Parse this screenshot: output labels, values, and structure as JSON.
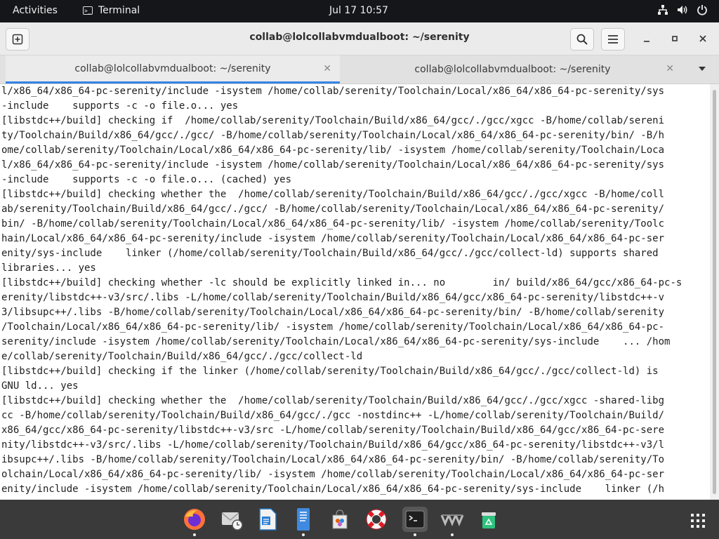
{
  "topbar": {
    "activities": "Activities",
    "app_name": "Terminal",
    "clock": "Jul 17  10:57",
    "tray_icons": [
      "network-icon",
      "volume-icon",
      "power-icon"
    ]
  },
  "window": {
    "title": "collab@lolcollabvmdualboot: ~/serenity",
    "tabs": [
      {
        "label": "collab@lolcollabvmdualboot: ~/serenity",
        "active": true
      },
      {
        "label": "collab@lolcollabvmdualboot: ~/serenity",
        "active": false
      }
    ]
  },
  "terminal": {
    "lines": [
      "l/x86_64/x86_64-pc-serenity/include -isystem /home/collab/serenity/Toolchain/Local/x86_64/x86_64-pc-serenity/sys",
      "-include    supports -c -o file.o... yes",
      "[libstdc++/build] checking if  /home/collab/serenity/Toolchain/Build/x86_64/gcc/./gcc/xgcc -B/home/collab/sereni",
      "ty/Toolchain/Build/x86_64/gcc/./gcc/ -B/home/collab/serenity/Toolchain/Local/x86_64/x86_64-pc-serenity/bin/ -B/h",
      "ome/collab/serenity/Toolchain/Local/x86_64/x86_64-pc-serenity/lib/ -isystem /home/collab/serenity/Toolchain/Loca",
      "l/x86_64/x86_64-pc-serenity/include -isystem /home/collab/serenity/Toolchain/Local/x86_64/x86_64-pc-serenity/sys",
      "-include    supports -c -o file.o... (cached) yes",
      "[libstdc++/build] checking whether the  /home/collab/serenity/Toolchain/Build/x86_64/gcc/./gcc/xgcc -B/home/coll",
      "ab/serenity/Toolchain/Build/x86_64/gcc/./gcc/ -B/home/collab/serenity/Toolchain/Local/x86_64/x86_64-pc-serenity/",
      "bin/ -B/home/collab/serenity/Toolchain/Local/x86_64/x86_64-pc-serenity/lib/ -isystem /home/collab/serenity/Toolc",
      "hain/Local/x86_64/x86_64-pc-serenity/include -isystem /home/collab/serenity/Toolchain/Local/x86_64/x86_64-pc-ser",
      "enity/sys-include    linker (/home/collab/serenity/Toolchain/Build/x86_64/gcc/./gcc/collect-ld) supports shared",
      "libraries... yes",
      "[libstdc++/build] checking whether -lc should be explicitly linked in... no        in/ build/x86_64/gcc/x86_64-pc-s",
      "erenity/libstdc++-v3/src/.libs -L/home/collab/serenity/Toolchain/Build/x86_64/gcc/x86_64-pc-serenity/libstdc++-v",
      "3/libsupc++/.libs -B/home/collab/serenity/Toolchain/Local/x86_64/x86_64-pc-serenity/bin/ -B/home/collab/serenity",
      "/Toolchain/Local/x86_64/x86_64-pc-serenity/lib/ -isystem /home/collab/serenity/Toolchain/Local/x86_64/x86_64-pc-",
      "serenity/include -isystem /home/collab/serenity/Toolchain/Local/x86_64/x86_64-pc-serenity/sys-include    ... /hom",
      "e/collab/serenity/Toolchain/Build/x86_64/gcc/./gcc/collect-ld",
      "[libstdc++/build] checking if the linker (/home/collab/serenity/Toolchain/Build/x86_64/gcc/./gcc/collect-ld) is",
      "GNU ld... yes",
      "[libstdc++/build] checking whether the  /home/collab/serenity/Toolchain/Build/x86_64/gcc/./gcc/xgcc -shared-libg",
      "cc -B/home/collab/serenity/Toolchain/Build/x86_64/gcc/./gcc -nostdinc++ -L/home/collab/serenity/Toolchain/Build/",
      "x86_64/gcc/x86_64-pc-serenity/libstdc++-v3/src -L/home/collab/serenity/Toolchain/Build/x86_64/gcc/x86_64-pc-sere",
      "nity/libstdc++-v3/src/.libs -L/home/collab/serenity/Toolchain/Build/x86_64/gcc/x86_64-pc-serenity/libstdc++-v3/l",
      "ibsupc++/.libs -B/home/collab/serenity/Toolchain/Local/x86_64/x86_64-pc-serenity/bin/ -B/home/collab/serenity/To",
      "olchain/Local/x86_64/x86_64-pc-serenity/lib/ -isystem /home/collab/serenity/Toolchain/Local/x86_64/x86_64-pc-ser",
      "enity/include -isystem /home/collab/serenity/Toolchain/Local/x86_64/x86_64-pc-serenity/sys-include    linker (/h"
    ]
  },
  "dock": {
    "items": [
      {
        "name": "firefox-icon",
        "running": true
      },
      {
        "name": "mail-clock-icon",
        "running": false
      },
      {
        "name": "writer-document-icon",
        "running": false
      },
      {
        "name": "text-editor-icon",
        "running": true
      },
      {
        "name": "software-store-icon",
        "running": false
      },
      {
        "name": "help-lifebuoy-icon",
        "running": false
      },
      {
        "name": "terminal-icon",
        "running": true
      },
      {
        "name": "virtual-machine-icon",
        "running": true
      },
      {
        "name": "trash-recycle-icon",
        "running": false
      }
    ]
  },
  "colors": {
    "accent": "#3584e4",
    "topbar_bg": "#15161a",
    "terminal_bg": "#ffffff",
    "terminal_fg": "#1f1f1f"
  }
}
